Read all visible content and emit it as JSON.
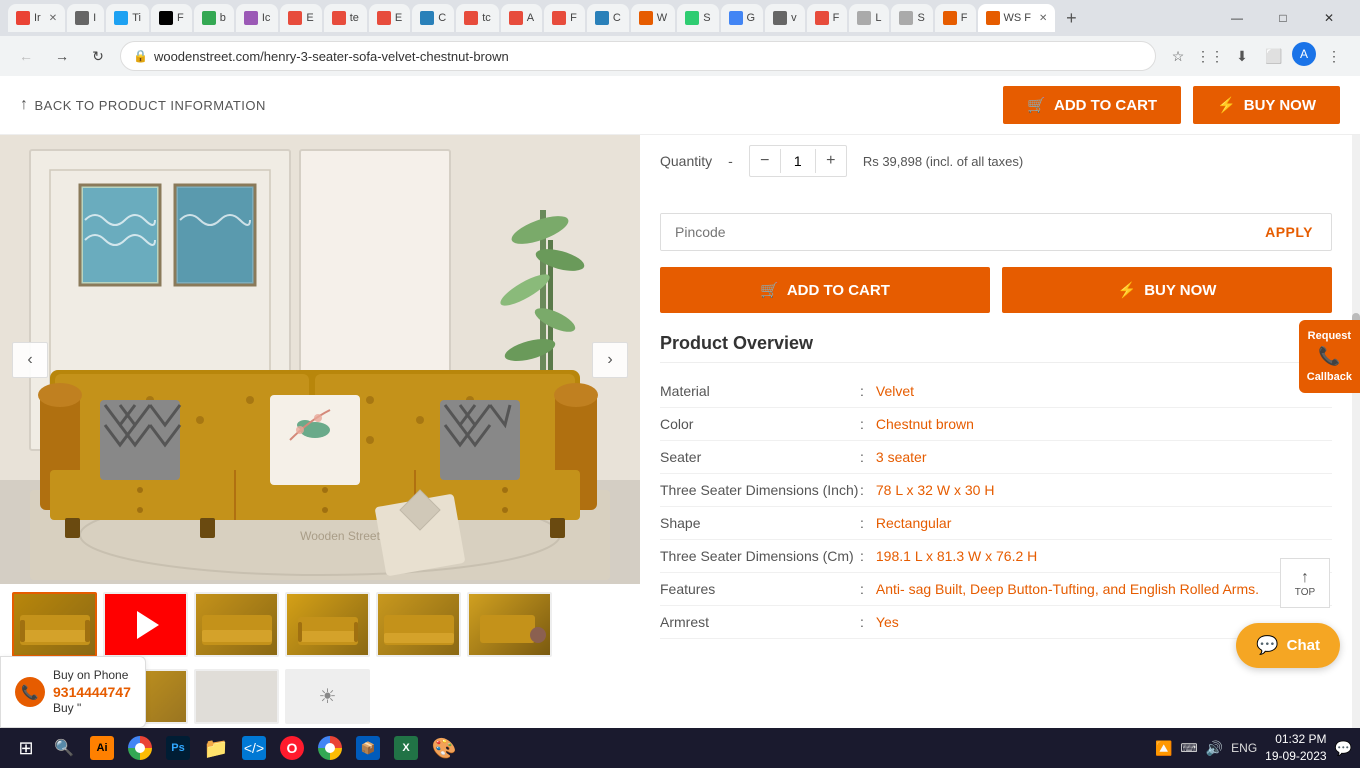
{
  "browser": {
    "tabs": [
      {
        "id": "tab1",
        "label": "Ir",
        "favicon": "gmail",
        "active": false
      },
      {
        "id": "tab2",
        "label": "I",
        "favicon": "default",
        "active": false
      },
      {
        "id": "tab3",
        "label": "Ti",
        "favicon": "default",
        "active": false
      },
      {
        "id": "tab4",
        "label": "F",
        "favicon": "twitter",
        "active": false
      },
      {
        "id": "tab5",
        "label": "b",
        "favicon": "green",
        "active": false
      },
      {
        "id": "tab6",
        "label": "Ic",
        "favicon": "default",
        "active": false
      },
      {
        "id": "tab7",
        "label": "E",
        "favicon": "default",
        "active": false
      },
      {
        "id": "tab8",
        "label": "te",
        "favicon": "default",
        "active": false
      },
      {
        "id": "tab9",
        "label": "E",
        "favicon": "default",
        "active": false
      },
      {
        "id": "tab10",
        "label": "C",
        "favicon": "default",
        "active": false
      },
      {
        "id": "tab11",
        "label": "tc",
        "favicon": "default",
        "active": false
      },
      {
        "id": "tab12",
        "label": "A",
        "favicon": "default",
        "active": false
      },
      {
        "id": "tab13",
        "label": "Fi",
        "favicon": "default",
        "active": false
      },
      {
        "id": "tab14",
        "label": "C",
        "favicon": "default",
        "active": false
      },
      {
        "id": "tab15",
        "label": "W",
        "favicon": "ws",
        "active": false
      },
      {
        "id": "tab16",
        "label": "S",
        "favicon": "default",
        "active": false
      },
      {
        "id": "tab17",
        "label": "G",
        "favicon": "default",
        "active": false
      },
      {
        "id": "tab18",
        "label": "v",
        "favicon": "default",
        "active": false
      },
      {
        "id": "tab19",
        "label": "F",
        "favicon": "default",
        "active": false
      },
      {
        "id": "tab20",
        "label": "L",
        "favicon": "default",
        "active": false
      },
      {
        "id": "tab21",
        "label": "S",
        "favicon": "default",
        "active": false
      },
      {
        "id": "tab22",
        "label": "F",
        "favicon": "ws",
        "active": false
      },
      {
        "id": "tab-active",
        "label": "WS F",
        "favicon": "ws",
        "active": true
      }
    ],
    "url": "woodenstreet.com/henry-3-seater-sofa-velvet-chestnut-brown",
    "window_controls": {
      "minimize": "—",
      "maximize": "□",
      "close": "✕"
    }
  },
  "topbar": {
    "back_label": "BACK TO PRODUCT INFORMATION",
    "add_to_cart_label": "ADD TO CART",
    "buy_now_label": "BUY NOW"
  },
  "product": {
    "image_watermark": "Wooden Street",
    "quantity_label": "Quantity",
    "quantity_value": "1",
    "price": "Rs 39,898 (incl. of all taxes)",
    "pincode_placeholder": "Pincode",
    "pincode_apply": "APPLY",
    "add_to_cart_label": "ADD TO CART",
    "buy_now_label": "BUY NOW",
    "overview_title": "Product Overview",
    "specs": [
      {
        "label": "Material",
        "value": "Velvet"
      },
      {
        "label": "Color",
        "value": "Chestnut brown"
      },
      {
        "label": "Seater",
        "value": "3 seater"
      },
      {
        "label": "Three Seater Dimensions (Inch)",
        "value": "78 L x 32 W x 30 H"
      },
      {
        "label": "Shape",
        "value": "Rectangular"
      },
      {
        "label": "Three Seater Dimensions (Cm)",
        "value": "198.1 L x 81.3 W x 76.2 H"
      },
      {
        "label": "Features",
        "value": "Anti- sag Built, Deep Button-Tufting, and English Rolled Arms."
      },
      {
        "label": "Armrest",
        "value": "Yes"
      }
    ],
    "thumbnails": [
      {
        "id": "th1",
        "class": "th1",
        "label": "sofa front view"
      },
      {
        "id": "th2",
        "class": "th-youtube",
        "label": "video thumbnail"
      },
      {
        "id": "th3",
        "class": "th3",
        "label": "sofa side view"
      },
      {
        "id": "th4",
        "class": "th4",
        "label": "sofa angle view"
      },
      {
        "id": "th5",
        "class": "th5",
        "label": "sofa detail view"
      },
      {
        "id": "th6",
        "class": "th5",
        "label": "sofa with person"
      }
    ]
  },
  "floating": {
    "request_label": "Request",
    "callback_label": "Callback",
    "chat_label": "Chat",
    "buy_phone_label": "Buy on Phone",
    "phone_number": "9314444747",
    "buy_text": "Buy \""
  },
  "taskbar": {
    "time": "01:32 PM",
    "date": "19-09-2023",
    "language": "ENG",
    "start_icon": "⊞",
    "items": [
      {
        "icon": "🔍",
        "name": "search"
      },
      {
        "icon": "🌐",
        "name": "browser"
      },
      {
        "icon": "🎨",
        "name": "illustrator"
      },
      {
        "icon": "🌐",
        "name": "chrome"
      },
      {
        "icon": "🖼",
        "name": "photoshop"
      },
      {
        "icon": "📁",
        "name": "explorer"
      },
      {
        "icon": "💻",
        "name": "vscode"
      },
      {
        "icon": "🔴",
        "name": "opera"
      },
      {
        "icon": "🌐",
        "name": "chrome2"
      },
      {
        "icon": "📦",
        "name": "app1"
      },
      {
        "icon": "📊",
        "name": "excel"
      },
      {
        "icon": "🎨",
        "name": "paint"
      }
    ]
  }
}
